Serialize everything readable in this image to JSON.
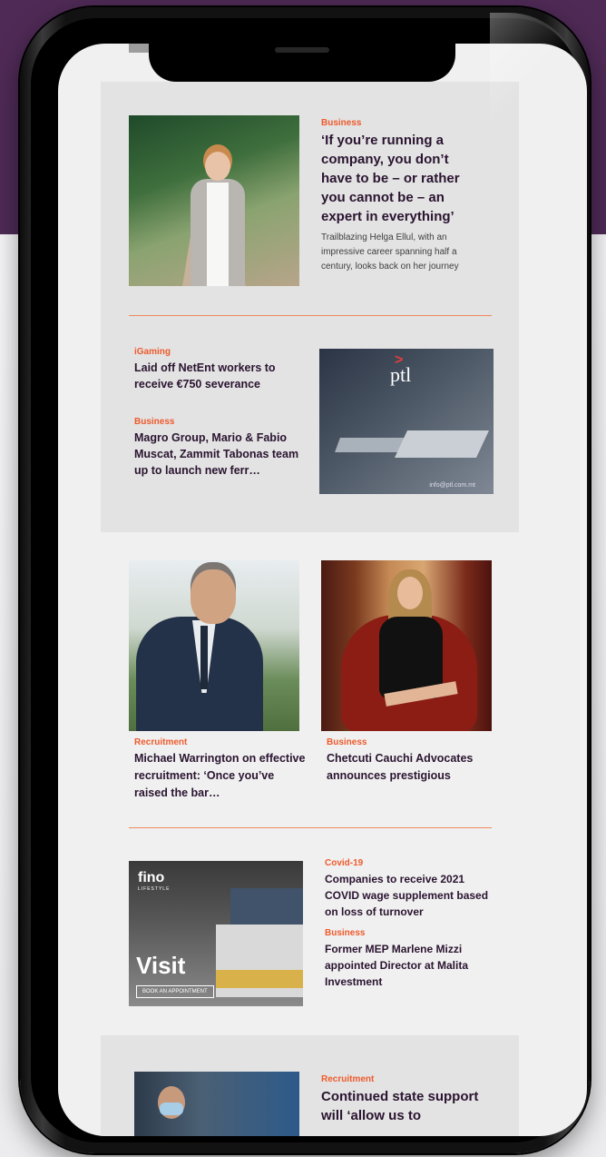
{
  "articles": {
    "a1": {
      "category": "Business",
      "title": "‘If you’re running a company, you don’t have to be – or rather you cannot be – an expert in everything’",
      "summary": "Trailblazing Helga Ellul, with an impressive career spanning half a century, looks back on her journey"
    },
    "a2": {
      "category": "iGaming",
      "title": "Laid off NetEnt workers to receive €750 severance"
    },
    "a3": {
      "category": "Business",
      "title": "Magro Group, Mario & Fabio Muscat, Zammit Tabonas team up to launch new ferr…"
    },
    "a4": {
      "category": "Recruitment",
      "title": "Michael Warrington on effective recruitment: ‘Once you’ve raised the bar…"
    },
    "a5": {
      "category": "Business",
      "title": "Chetcuti Cauchi Advocates announces prestigious"
    },
    "a6": {
      "category": "Covid-19",
      "title": "Companies to receive 2021 COVID wage supplement based on loss of turnover"
    },
    "a7": {
      "category": "Business",
      "title": "Former MEP Marlene Mizzi appointed Director at Malita Investment"
    },
    "a8": {
      "category": "Recruitment",
      "title": "Continued state support will ‘allow us to"
    }
  },
  "ads": {
    "ptl": {
      "logo": "ptl",
      "email": "info@ptl.com.mt"
    },
    "fino": {
      "brand": "fino",
      "tagline": "LIFESTYLE",
      "headline": "Visit",
      "button": "BOOK AN APPOINTMENT"
    }
  }
}
